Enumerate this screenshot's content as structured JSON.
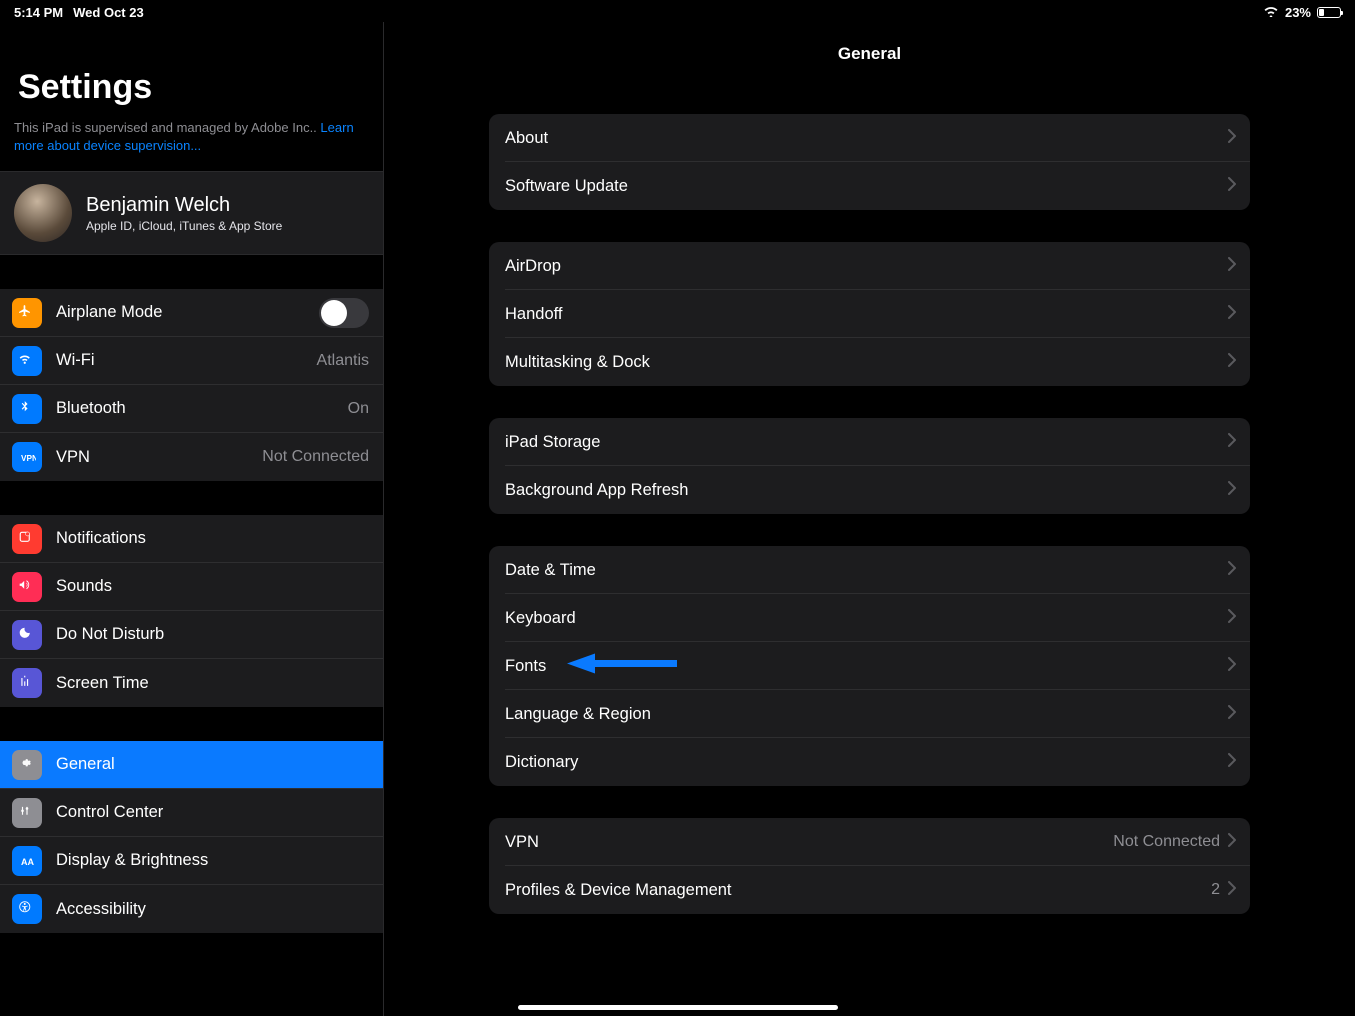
{
  "status": {
    "time": "5:14 PM",
    "date": "Wed Oct 23",
    "battery_pct": "23%"
  },
  "sidebar": {
    "title": "Settings",
    "supervision_text": "This iPad is supervised and managed by Adobe Inc.. ",
    "supervision_link": "Learn more about device supervision...",
    "profile": {
      "name": "Benjamin Welch",
      "subtitle": "Apple ID, iCloud, iTunes & App Store"
    },
    "groups": [
      {
        "rows": [
          {
            "key": "airplane",
            "label": "Airplane Mode",
            "toggle": true
          },
          {
            "key": "wifi",
            "label": "Wi-Fi",
            "value": "Atlantis"
          },
          {
            "key": "bluetooth",
            "label": "Bluetooth",
            "value": "On"
          },
          {
            "key": "vpn",
            "label": "VPN",
            "value": "Not Connected"
          }
        ]
      },
      {
        "rows": [
          {
            "key": "notifications",
            "label": "Notifications"
          },
          {
            "key": "sounds",
            "label": "Sounds"
          },
          {
            "key": "dnd",
            "label": "Do Not Disturb"
          },
          {
            "key": "screentime",
            "label": "Screen Time"
          }
        ]
      },
      {
        "rows": [
          {
            "key": "general",
            "label": "General",
            "selected": true
          },
          {
            "key": "controlcenter",
            "label": "Control Center"
          },
          {
            "key": "display",
            "label": "Display & Brightness"
          },
          {
            "key": "accessibility",
            "label": "Accessibility"
          }
        ]
      }
    ]
  },
  "main": {
    "title": "General",
    "groups": [
      {
        "rows": [
          {
            "label": "About"
          },
          {
            "label": "Software Update"
          }
        ]
      },
      {
        "rows": [
          {
            "label": "AirDrop"
          },
          {
            "label": "Handoff"
          },
          {
            "label": "Multitasking & Dock"
          }
        ]
      },
      {
        "rows": [
          {
            "label": "iPad Storage"
          },
          {
            "label": "Background App Refresh"
          }
        ]
      },
      {
        "rows": [
          {
            "label": "Date & Time"
          },
          {
            "label": "Keyboard"
          },
          {
            "label": "Fonts",
            "annotated": true
          },
          {
            "label": "Language & Region"
          },
          {
            "label": "Dictionary"
          }
        ]
      },
      {
        "rows": [
          {
            "label": "VPN",
            "value": "Not Connected"
          },
          {
            "label": "Profiles & Device Management",
            "value": "2"
          }
        ]
      }
    ]
  },
  "icons": {
    "airplane": {
      "bg": "#ff9500"
    },
    "wifi": {
      "bg": "#007aff"
    },
    "bluetooth": {
      "bg": "#007aff"
    },
    "vpn": {
      "bg": "#007aff"
    },
    "notifications": {
      "bg": "#ff3b30"
    },
    "sounds": {
      "bg": "#ff2d55"
    },
    "dnd": {
      "bg": "#5856d6"
    },
    "screentime": {
      "bg": "#5856d6"
    },
    "general": {
      "bg": "#8e8e93"
    },
    "controlcenter": {
      "bg": "#8e8e93"
    },
    "display": {
      "bg": "#007aff"
    },
    "accessibility": {
      "bg": "#007aff"
    }
  }
}
